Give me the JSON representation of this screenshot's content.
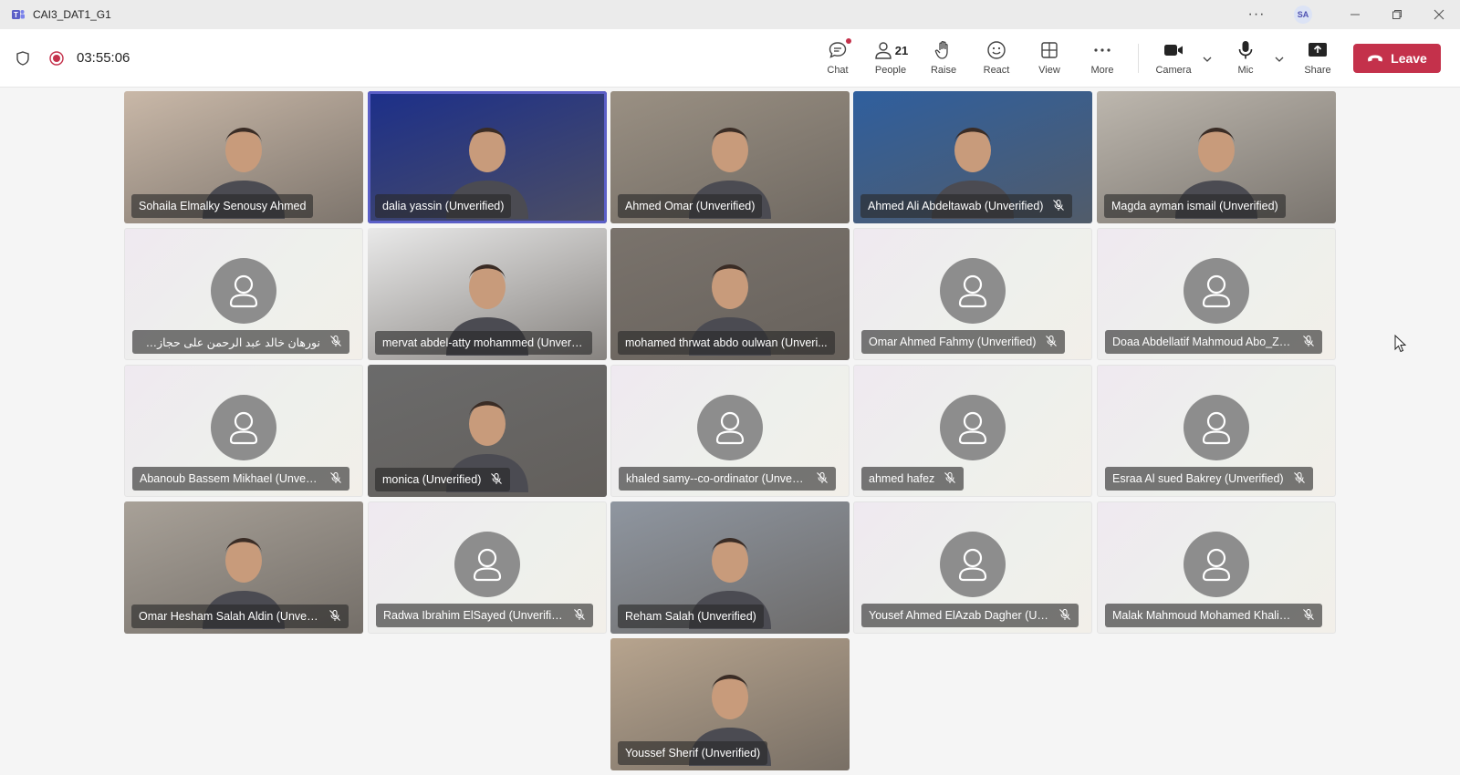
{
  "window": {
    "title": "CAI3_DAT1_G1",
    "more": "···",
    "user_initials": "SA"
  },
  "toolbar": {
    "timer": "03:55:06",
    "chat_label": "Chat",
    "people_label": "People",
    "people_count": "21",
    "raise_label": "Raise",
    "react_label": "React",
    "view_label": "View",
    "more_label": "More",
    "camera_label": "Camera",
    "mic_label": "Mic",
    "share_label": "Share",
    "leave_label": "Leave"
  },
  "participants": [
    {
      "name": "Sohaila Elmalky Senousy Ahmed",
      "muted": false,
      "video": true,
      "bg": "#c9b8a8"
    },
    {
      "name": "dalia yassin (Unverified)",
      "muted": false,
      "video": true,
      "bg": "#1c2f8a",
      "active": true
    },
    {
      "name": "Ahmed Omar (Unverified)",
      "muted": false,
      "video": true,
      "bg": "#9a9083"
    },
    {
      "name": "Ahmed Ali Abdeltawab (Unverified)",
      "muted": true,
      "video": true,
      "bg": "#2f5f9e"
    },
    {
      "name": "Magda ayman ismail (Unverified)",
      "muted": false,
      "video": true,
      "bg": "#bdb7ae"
    },
    {
      "name": "نورهان خالد عبد الرحمن على حجازى (...",
      "muted": true,
      "video": false
    },
    {
      "name": "mervat abdel-atty mohammed (Unverif...",
      "muted": false,
      "video": true,
      "bg": "#e9e9e9"
    },
    {
      "name": "mohamed thrwat abdo oulwan (Unveri...",
      "muted": false,
      "video": true,
      "bg": "#7a736c"
    },
    {
      "name": "Omar Ahmed Fahmy (Unverified)",
      "muted": true,
      "video": false
    },
    {
      "name": "Doaa Abdellatif Mahmoud Abo_Ze...",
      "muted": true,
      "video": false
    },
    {
      "name": "Abanoub Bassem Mikhael (Unverif...",
      "muted": true,
      "video": false
    },
    {
      "name": "monica (Unverified)",
      "muted": true,
      "video": true,
      "bg": "#6b6b6b"
    },
    {
      "name": "khaled samy--co-ordinator (Unveri...",
      "muted": true,
      "video": false
    },
    {
      "name": "ahmed hafez",
      "muted": true,
      "video": false
    },
    {
      "name": "Esraa Al sued Bakrey (Unverified)",
      "muted": true,
      "video": false
    },
    {
      "name": "Omar Hesham Salah Aldin (Unverif...",
      "muted": true,
      "video": true,
      "bg": "#a8a198"
    },
    {
      "name": "Radwa Ibrahim ElSayed (Unverified)",
      "muted": true,
      "video": false
    },
    {
      "name": "Reham Salah (Unverified)",
      "muted": false,
      "video": true,
      "bg": "#8f96a0"
    },
    {
      "name": "Yousef Ahmed ElAzab Dagher (Un...",
      "muted": true,
      "video": false
    },
    {
      "name": "Malak Mahmoud Mohamed Khalil ...",
      "muted": true,
      "video": false
    },
    {
      "name": "Youssef Sherif (Unverified)",
      "muted": false,
      "video": true,
      "bg": "#b7a48e"
    }
  ]
}
